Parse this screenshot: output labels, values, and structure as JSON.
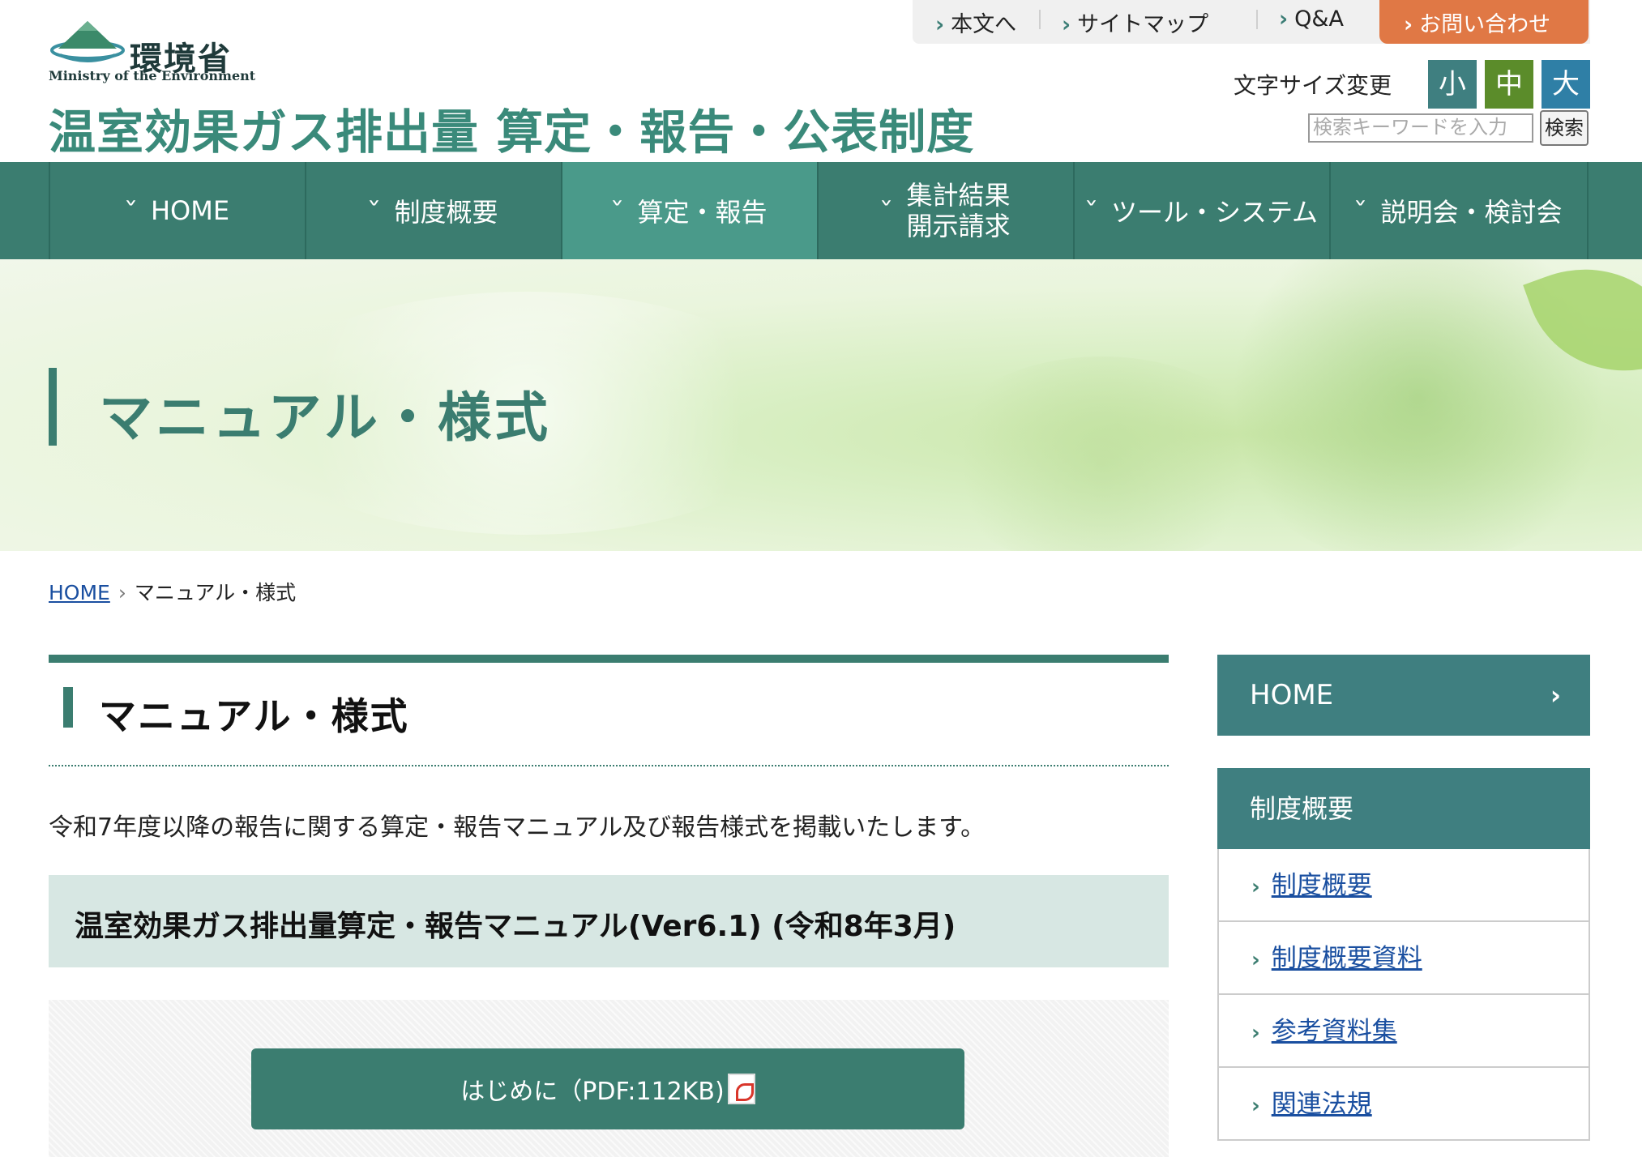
{
  "header": {
    "logo_jp": "環境省",
    "logo_en": "Ministry of the Environment",
    "site_title": "温室効果ガス排出量 算定・報告・公表制度"
  },
  "utility": {
    "links": [
      "本文へ",
      "サイトマップ",
      "Q&A"
    ],
    "contact": "お問い合わせ",
    "font_size_label": "文字サイズ変更",
    "font_sizes": [
      "小",
      "中",
      "大"
    ],
    "search_placeholder": "検索キーワードを入力",
    "search_button": "検索"
  },
  "gnav": {
    "items": [
      "HOME",
      "制度概要",
      "算定・報告",
      "集計結果",
      "開示請求",
      "ツール・システム",
      "説明会・検討会"
    ]
  },
  "hero": {
    "title": "マニュアル・様式"
  },
  "breadcrumb": {
    "home": "HOME",
    "current": "マニュアル・様式"
  },
  "main": {
    "heading": "マニュアル・様式",
    "description": "令和7年度以降の報告に関する算定・報告マニュアル及び報告様式を掲載いたします。",
    "section_title": "温室効果ガス排出量算定・報告マニュアル(Ver6.1) (令和8年3月)",
    "pdf_button": "はじめに（PDF:112KB)"
  },
  "sidebar": {
    "home": "HOME",
    "section_heading": "制度概要",
    "items": [
      "制度概要",
      "制度概要資料",
      "参考資料集",
      "関連法規"
    ]
  },
  "colors": {
    "primary": "#3b7d70",
    "site_title": "#3a8a7a",
    "contact": "#e07845",
    "font_small": "#3f7f80",
    "font_medium": "#5b8c2a",
    "font_large": "#2f7fa6",
    "section_bg": "#d7e7e3",
    "link": "#1a4fa0"
  },
  "icons": [
    "logo-mountain-icon",
    "chevron-right-icon",
    "chevron-down-icon",
    "pdf-icon"
  ]
}
